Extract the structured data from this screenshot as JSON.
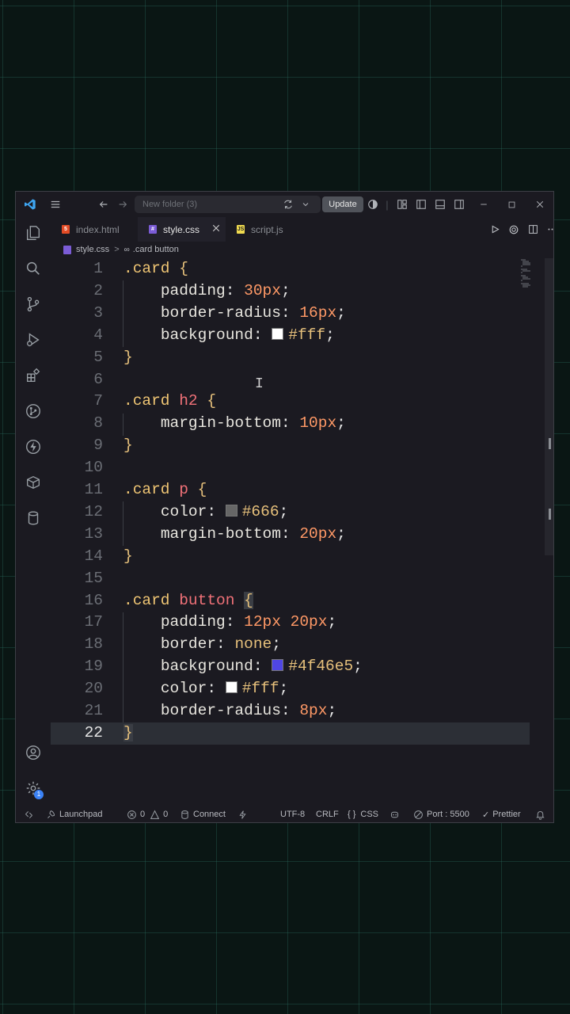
{
  "titlebar": {
    "search_placeholder": "New folder (3)",
    "update_label": "Update"
  },
  "tabs": [
    {
      "label": "index.html",
      "icon": "html5-icon",
      "color": "#e34c26"
    },
    {
      "label": "style.css",
      "icon": "css-icon",
      "color": "#7b5cd6"
    },
    {
      "label": "script.js",
      "icon": "js-icon",
      "color": "#f0db4f"
    }
  ],
  "breadcrumb": {
    "file": "style.css",
    "separator": ">",
    "symbol": ".card button"
  },
  "editor": {
    "line_numbers": [
      "1",
      "2",
      "3",
      "4",
      "5",
      "6",
      "7",
      "8",
      "9",
      "10",
      "11",
      "12",
      "13",
      "14",
      "15",
      "16",
      "17",
      "18",
      "19",
      "20",
      "21",
      "22"
    ],
    "current_line": 22
  },
  "statusbar": {
    "launchpad": "Launchpad",
    "errors": "0",
    "warnings": "0",
    "connect": "Connect",
    "encoding": "UTF-8",
    "eol": "CRLF",
    "language": "CSS",
    "port": "Port : 5500",
    "prettier": "Prettier",
    "settings_badge": "1"
  },
  "colors": {
    "selector": "#f0c674",
    "tag": "#f07178",
    "number": "#ff9966",
    "value": "#e6c07b",
    "swatch_fff": "#ffffff",
    "swatch_666": "#666666",
    "swatch_4f46e5": "#4f46e5"
  }
}
